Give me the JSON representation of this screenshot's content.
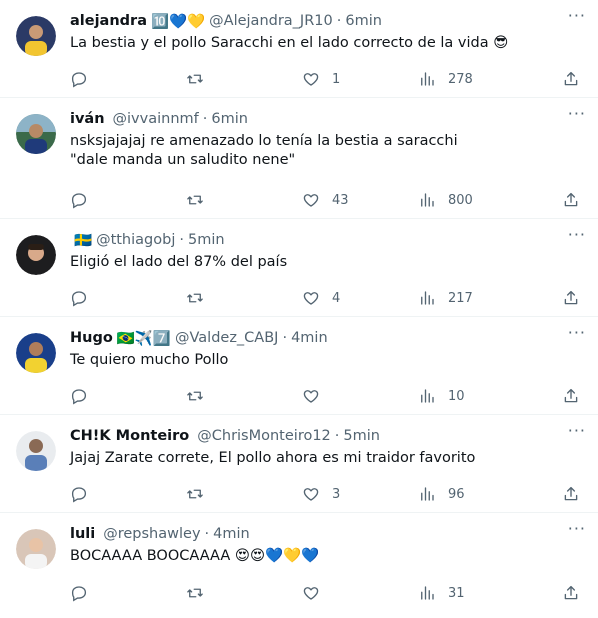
{
  "tweets": [
    {
      "name": "alejandra",
      "badges": "🔟💙💛",
      "handle": "@Alejandra_JR10",
      "separator": "·",
      "time": "6min",
      "text_lines": [
        "La bestia y el pollo Saracchi en el lado correcto de la vida 😎"
      ],
      "replies": "",
      "retweets": "",
      "likes": "1",
      "views": "278",
      "avatar_color": "#2b3a66"
    },
    {
      "name": "iván",
      "badges": "",
      "handle": "@ivvainnmf",
      "separator": "·",
      "time": "6min",
      "text_lines": [
        "nsksjajajaj re amenazado lo tenía la bestia a saracchi",
        "\"dale manda un saludito nene\""
      ],
      "replies": "",
      "retweets": "",
      "likes": "43",
      "views": "800",
      "avatar_color": "#3b6a4a"
    },
    {
      "name": "",
      "badges": "🇸🇪",
      "handle": "@tthiagobj",
      "separator": "·",
      "time": "5min",
      "text_lines": [
        "Eligió el lado del 87% del país"
      ],
      "replies": "",
      "retweets": "",
      "likes": "4",
      "views": "217",
      "avatar_color": "#1d1d1f"
    },
    {
      "name": "Hugo",
      "badges": "🇧🇷✈️7️⃣",
      "handle": "@Valdez_CABJ",
      "separator": "·",
      "time": "4min",
      "text_lines": [
        "Te quiero mucho Pollo"
      ],
      "replies": "",
      "retweets": "",
      "likes": "",
      "views": "10",
      "avatar_color": "#1a3f8a"
    },
    {
      "name": "CH!K Monteiro",
      "badges": "",
      "handle": "@ChrisMonteiro12",
      "separator": "·",
      "time": "5min",
      "text_lines": [
        "Jajaj Zarate correte, El pollo ahora es mi traidor favorito"
      ],
      "replies": "",
      "retweets": "",
      "likes": "3",
      "views": "96",
      "avatar_color": "#6a6a6a"
    },
    {
      "name": "luli",
      "badges": "",
      "handle": "@repshawley",
      "separator": "·",
      "time": "4min",
      "text_lines": [
        "BOCAAAA BOOCAAAA 😍😍💙💛💙"
      ],
      "replies": "",
      "retweets": "",
      "likes": "",
      "views": "31",
      "avatar_color": "#d9c6b8"
    }
  ]
}
